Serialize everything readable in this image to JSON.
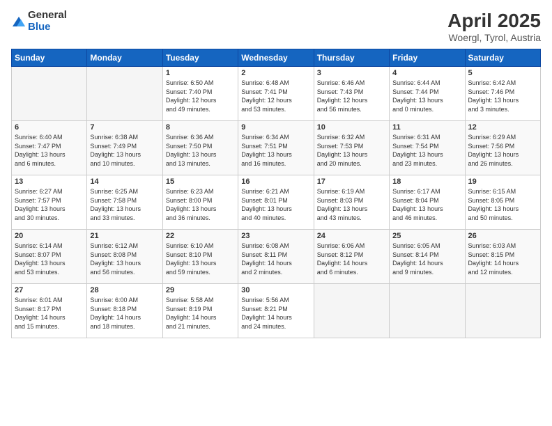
{
  "logo": {
    "general": "General",
    "blue": "Blue"
  },
  "title": {
    "main": "April 2025",
    "sub": "Woergl, Tyrol, Austria"
  },
  "headers": [
    "Sunday",
    "Monday",
    "Tuesday",
    "Wednesday",
    "Thursday",
    "Friday",
    "Saturday"
  ],
  "weeks": [
    [
      {
        "day": "",
        "info": ""
      },
      {
        "day": "",
        "info": ""
      },
      {
        "day": "1",
        "info": "Sunrise: 6:50 AM\nSunset: 7:40 PM\nDaylight: 12 hours\nand 49 minutes."
      },
      {
        "day": "2",
        "info": "Sunrise: 6:48 AM\nSunset: 7:41 PM\nDaylight: 12 hours\nand 53 minutes."
      },
      {
        "day": "3",
        "info": "Sunrise: 6:46 AM\nSunset: 7:43 PM\nDaylight: 12 hours\nand 56 minutes."
      },
      {
        "day": "4",
        "info": "Sunrise: 6:44 AM\nSunset: 7:44 PM\nDaylight: 13 hours\nand 0 minutes."
      },
      {
        "day": "5",
        "info": "Sunrise: 6:42 AM\nSunset: 7:46 PM\nDaylight: 13 hours\nand 3 minutes."
      }
    ],
    [
      {
        "day": "6",
        "info": "Sunrise: 6:40 AM\nSunset: 7:47 PM\nDaylight: 13 hours\nand 6 minutes."
      },
      {
        "day": "7",
        "info": "Sunrise: 6:38 AM\nSunset: 7:49 PM\nDaylight: 13 hours\nand 10 minutes."
      },
      {
        "day": "8",
        "info": "Sunrise: 6:36 AM\nSunset: 7:50 PM\nDaylight: 13 hours\nand 13 minutes."
      },
      {
        "day": "9",
        "info": "Sunrise: 6:34 AM\nSunset: 7:51 PM\nDaylight: 13 hours\nand 16 minutes."
      },
      {
        "day": "10",
        "info": "Sunrise: 6:32 AM\nSunset: 7:53 PM\nDaylight: 13 hours\nand 20 minutes."
      },
      {
        "day": "11",
        "info": "Sunrise: 6:31 AM\nSunset: 7:54 PM\nDaylight: 13 hours\nand 23 minutes."
      },
      {
        "day": "12",
        "info": "Sunrise: 6:29 AM\nSunset: 7:56 PM\nDaylight: 13 hours\nand 26 minutes."
      }
    ],
    [
      {
        "day": "13",
        "info": "Sunrise: 6:27 AM\nSunset: 7:57 PM\nDaylight: 13 hours\nand 30 minutes."
      },
      {
        "day": "14",
        "info": "Sunrise: 6:25 AM\nSunset: 7:58 PM\nDaylight: 13 hours\nand 33 minutes."
      },
      {
        "day": "15",
        "info": "Sunrise: 6:23 AM\nSunset: 8:00 PM\nDaylight: 13 hours\nand 36 minutes."
      },
      {
        "day": "16",
        "info": "Sunrise: 6:21 AM\nSunset: 8:01 PM\nDaylight: 13 hours\nand 40 minutes."
      },
      {
        "day": "17",
        "info": "Sunrise: 6:19 AM\nSunset: 8:03 PM\nDaylight: 13 hours\nand 43 minutes."
      },
      {
        "day": "18",
        "info": "Sunrise: 6:17 AM\nSunset: 8:04 PM\nDaylight: 13 hours\nand 46 minutes."
      },
      {
        "day": "19",
        "info": "Sunrise: 6:15 AM\nSunset: 8:05 PM\nDaylight: 13 hours\nand 50 minutes."
      }
    ],
    [
      {
        "day": "20",
        "info": "Sunrise: 6:14 AM\nSunset: 8:07 PM\nDaylight: 13 hours\nand 53 minutes."
      },
      {
        "day": "21",
        "info": "Sunrise: 6:12 AM\nSunset: 8:08 PM\nDaylight: 13 hours\nand 56 minutes."
      },
      {
        "day": "22",
        "info": "Sunrise: 6:10 AM\nSunset: 8:10 PM\nDaylight: 13 hours\nand 59 minutes."
      },
      {
        "day": "23",
        "info": "Sunrise: 6:08 AM\nSunset: 8:11 PM\nDaylight: 14 hours\nand 2 minutes."
      },
      {
        "day": "24",
        "info": "Sunrise: 6:06 AM\nSunset: 8:12 PM\nDaylight: 14 hours\nand 6 minutes."
      },
      {
        "day": "25",
        "info": "Sunrise: 6:05 AM\nSunset: 8:14 PM\nDaylight: 14 hours\nand 9 minutes."
      },
      {
        "day": "26",
        "info": "Sunrise: 6:03 AM\nSunset: 8:15 PM\nDaylight: 14 hours\nand 12 minutes."
      }
    ],
    [
      {
        "day": "27",
        "info": "Sunrise: 6:01 AM\nSunset: 8:17 PM\nDaylight: 14 hours\nand 15 minutes."
      },
      {
        "day": "28",
        "info": "Sunrise: 6:00 AM\nSunset: 8:18 PM\nDaylight: 14 hours\nand 18 minutes."
      },
      {
        "day": "29",
        "info": "Sunrise: 5:58 AM\nSunset: 8:19 PM\nDaylight: 14 hours\nand 21 minutes."
      },
      {
        "day": "30",
        "info": "Sunrise: 5:56 AM\nSunset: 8:21 PM\nDaylight: 14 hours\nand 24 minutes."
      },
      {
        "day": "",
        "info": ""
      },
      {
        "day": "",
        "info": ""
      },
      {
        "day": "",
        "info": ""
      }
    ]
  ]
}
